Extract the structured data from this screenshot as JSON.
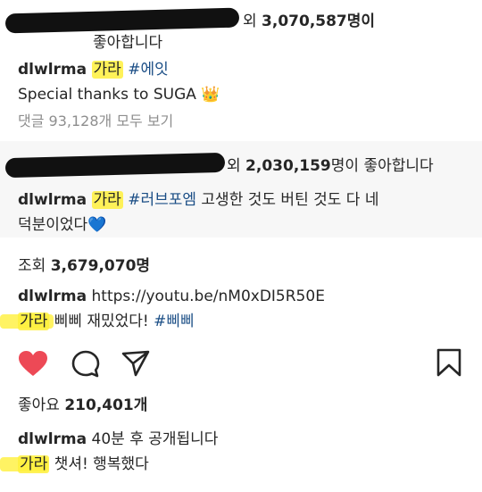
{
  "post1": {
    "likes_suffix": "외",
    "likes_count": "3,070,587",
    "likes_unit": "명이",
    "likes_line2": "좋아합니다",
    "username": "dlwlrma",
    "caption_highlight": "가라",
    "hashtag": "#에잇",
    "caption_line2": "Special thanks to SUGA",
    "crown_emoji": "👑",
    "comments_link": "댓글 93,128개 모두 보기"
  },
  "post2": {
    "likes_suffix": "외",
    "likes_count": "2,030,159",
    "likes_unit": "명이 좋아합니다",
    "username": "dlwlrma",
    "caption_highlight": "가라",
    "hashtag": "#러브포엠",
    "caption_text": "고생한 것도 버틴 것도 다 네",
    "caption_line2": "덕분이었다",
    "heart_emoji": "💙"
  },
  "post3": {
    "views_label": "조회",
    "views_count": "3,679,070명",
    "username": "dlwlrma",
    "link": "https://youtu.be/nM0xDI5R50E",
    "caption_highlight": "가라",
    "caption_text": "삐삐 재밌었다!",
    "hashtag": "#삐삐"
  },
  "post4": {
    "likes_label": "좋아요",
    "likes_count": "210,401개",
    "username": "dlwlrma",
    "comment_text": "40분 후 공개됩니다",
    "caption_highlight": "가라",
    "caption_text": "챗셔! 행복했다"
  },
  "colors": {
    "accent_blue": "#1b4e86",
    "like_red": "#ed4956",
    "highlight_yellow": "#fff03c",
    "muted_grey": "#8e8e8e"
  },
  "icons": [
    "heart-icon",
    "comment-icon",
    "share-icon",
    "bookmark-icon"
  ]
}
